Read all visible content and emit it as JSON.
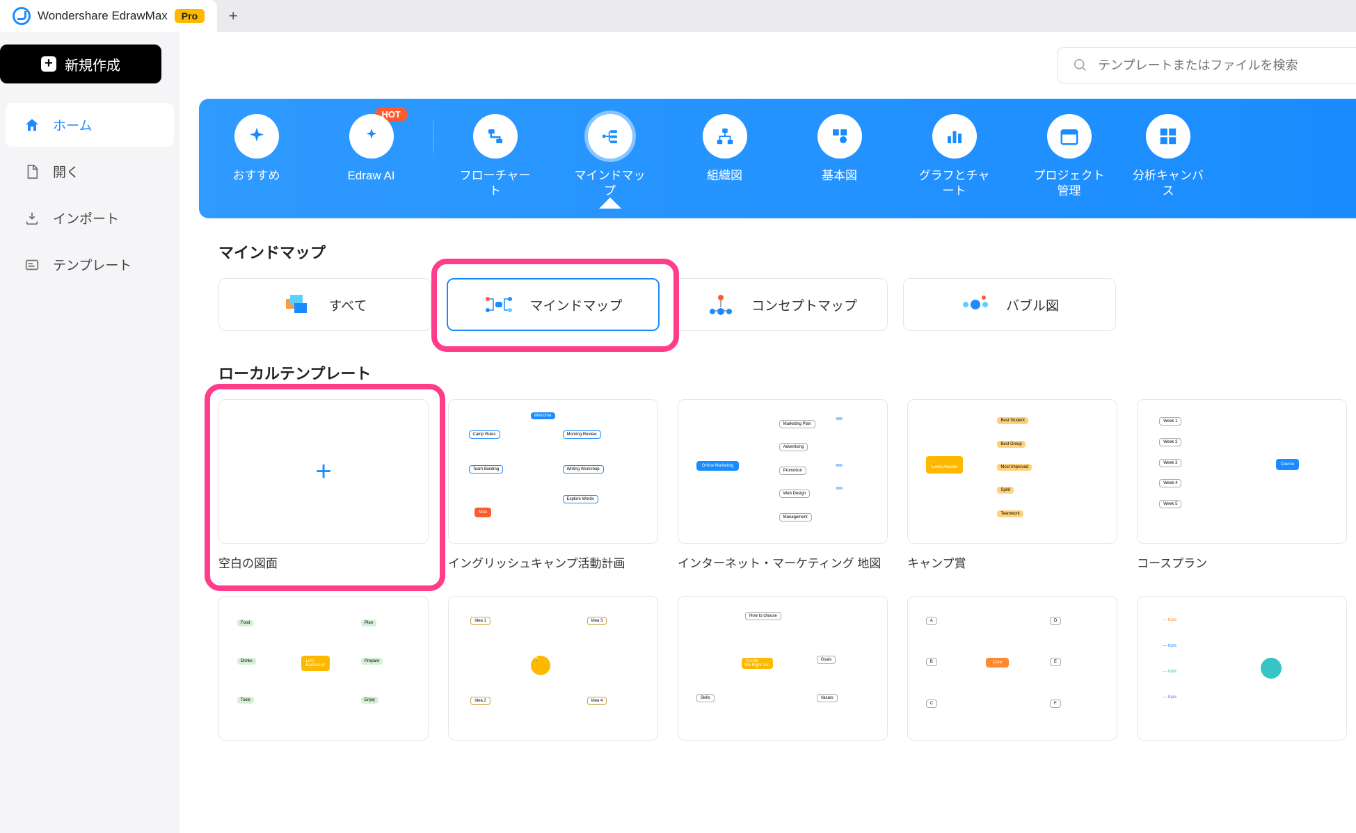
{
  "titlebar": {
    "app_name": "Wondershare EdrawMax",
    "pro": "Pro"
  },
  "sidebar": {
    "new_button": "新規作成",
    "items": [
      {
        "label": "ホーム",
        "icon": "home"
      },
      {
        "label": "開く",
        "icon": "file"
      },
      {
        "label": "インポート",
        "icon": "download"
      },
      {
        "label": "テンプレート",
        "icon": "template"
      }
    ]
  },
  "search": {
    "placeholder": "テンプレートまたはファイルを検索"
  },
  "categories": [
    {
      "label": "おすすめ",
      "icon": "sparkle"
    },
    {
      "label": "Edraw AI",
      "icon": "ai",
      "hot": "HOT"
    },
    {
      "label": "フローチャート",
      "icon": "flow"
    },
    {
      "label": "マインドマップ",
      "icon": "mindmap",
      "selected": true
    },
    {
      "label": "組織図",
      "icon": "org"
    },
    {
      "label": "基本図",
      "icon": "basic"
    },
    {
      "label": "グラフとチャート",
      "icon": "chart"
    },
    {
      "label": "プロジェクト管理",
      "icon": "project"
    },
    {
      "label": "分析キャンバス",
      "icon": "grid"
    }
  ],
  "section_mindmap_title": "マインドマップ",
  "filters": [
    {
      "label": "すべて",
      "icon": "all"
    },
    {
      "label": "マインドマップ",
      "icon": "mindmap",
      "selected": true,
      "highlight": true
    },
    {
      "label": "コンセプトマップ",
      "icon": "concept"
    },
    {
      "label": "バブル図",
      "icon": "bubble"
    }
  ],
  "section_local_title": "ローカルテンプレート",
  "templates_row1": [
    {
      "label": "空白の図面",
      "blank": true,
      "highlight": true
    },
    {
      "label": "イングリッシュキャンプ活動計画"
    },
    {
      "label": "インターネット・マーケティング 地図"
    },
    {
      "label": "キャンプ賞"
    },
    {
      "label": "コースプラン"
    }
  ],
  "templates_row2": [
    {
      "label": ""
    },
    {
      "label": ""
    },
    {
      "label": ""
    },
    {
      "label": ""
    },
    {
      "label": ""
    }
  ]
}
